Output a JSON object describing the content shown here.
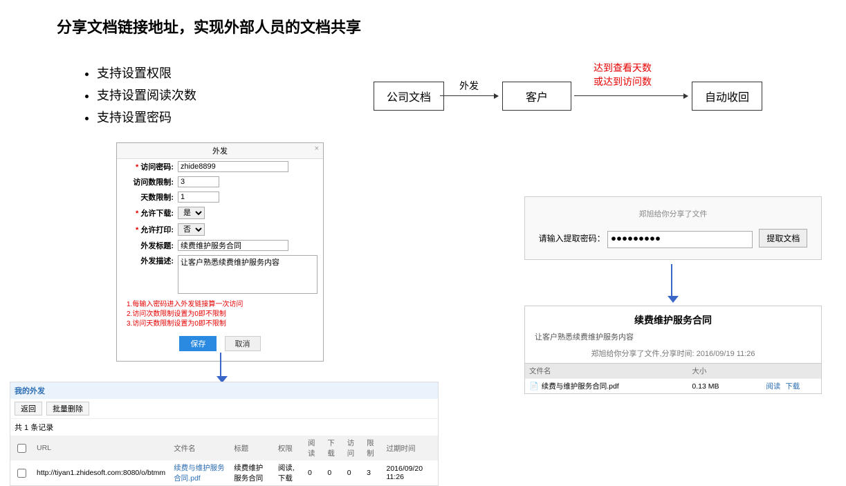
{
  "title": "分享文档链接地址，实现外部人员的文档共享",
  "bullets": [
    "支持设置权限",
    "支持设置阅读次数",
    "支持设置密码"
  ],
  "flow": {
    "box1": "公司文档",
    "label1": "外发",
    "box2": "客户",
    "label2a": "达到查看天数",
    "label2b": "或达到访问数",
    "box3": "自动收回"
  },
  "dialog": {
    "title": "外发",
    "fields": {
      "password_label": "访问密码:",
      "password_value": "zhide8899",
      "visit_limit_label": "访问数限制:",
      "visit_limit_value": "3",
      "day_limit_label": "天数限制:",
      "day_limit_value": "1",
      "allow_download_label": "允许下载:",
      "allow_download_value": "是",
      "allow_print_label": "允许打印:",
      "allow_print_value": "否",
      "title_label": "外发标题:",
      "title_value": "续费维护服务合同",
      "desc_label": "外发描述:",
      "desc_value": "让客户熟悉续费维护服务内容"
    },
    "notes": [
      "1.每输入密码进入外发链接算一次访问",
      "2.访问次数限制设置为0即不限制",
      "3.访问天数限制设置为0即不限制"
    ],
    "save": "保存",
    "cancel": "取消"
  },
  "table": {
    "header": "我的外发",
    "back": "返回",
    "batch_delete": "批量删除",
    "record_count": "共 1 条记录",
    "columns": [
      "",
      "URL",
      "文件名",
      "标题",
      "权限",
      "阅读",
      "下载",
      "访问",
      "限制",
      "过期时间"
    ],
    "row": {
      "url": "http://tiyan1.zhidesoft.com:8080/o/btmm",
      "filename": "续费与维护服务合同.pdf",
      "title": "续费维护服务合同",
      "perm": "阅读,下载",
      "read": "0",
      "download": "0",
      "visit": "0",
      "limit": "3",
      "expire": "2016/09/20 11:26"
    }
  },
  "pw_card": {
    "share_by": "郑旭给你分享了文件",
    "prompt": "请输入提取密码：",
    "password": "●●●●●●●●●",
    "button": "提取文档"
  },
  "file_card": {
    "title": "续费维护服务合同",
    "sub": "让客户熟悉续费维护服务内容",
    "meta": "郑旭给你分享了文件,分享时间: 2016/09/19 11:26",
    "col_name": "文件名",
    "col_size": "大小",
    "filename": "续费与维护服务合同.pdf",
    "size": "0.13 MB",
    "read_link": "阅读",
    "download_link": "下载"
  }
}
